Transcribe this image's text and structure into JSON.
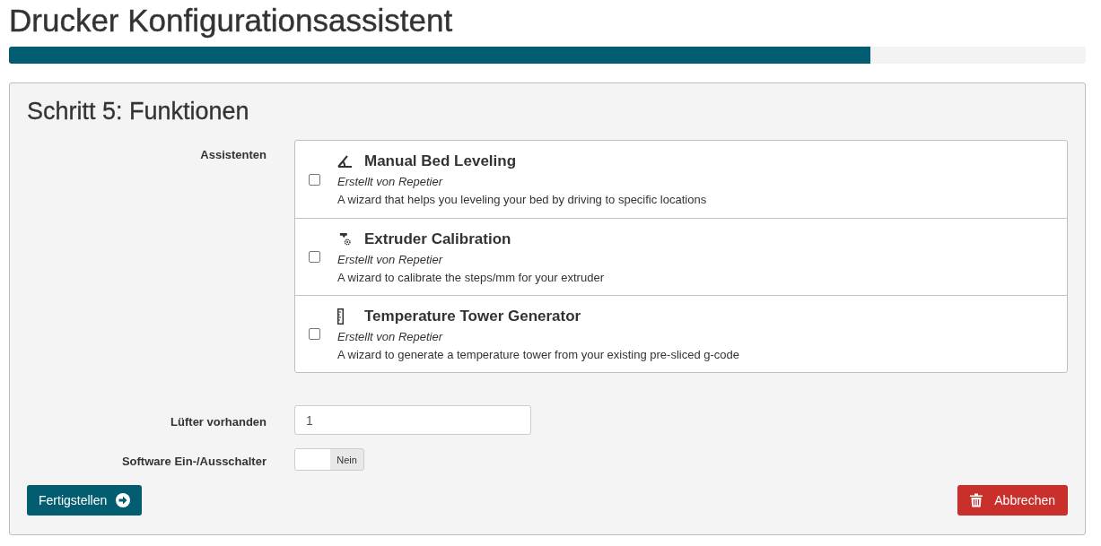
{
  "header": {
    "title": "Drucker Konfigurationsassistent"
  },
  "progress": {
    "level": 0.8
  },
  "step": {
    "title": "Schritt 5: Funktionen",
    "fields": [
      {
        "kind": "wizards",
        "label": "Assistenten",
        "items": [
          {
            "kind": "angle",
            "name": "Manual Bed Leveling",
            "author": "Erstellt von Repetier",
            "description": "A wizard that helps you leveling your bed by driving to specific locations",
            "checked": false
          },
          {
            "kind": "extruder",
            "name": "Extruder Calibration",
            "author": "Erstellt von Repetier",
            "description": "A wizard to calibrate the steps/mm for your extruder",
            "checked": false
          },
          {
            "kind": "ruler",
            "name": "Temperature Tower Generator",
            "author": "Erstellt von Repetier",
            "description": "A wizard to generate a temperature tower from your existing pre-sliced g-code",
            "checked": false
          }
        ]
      },
      {
        "kind": "input",
        "label": "Lüfter vorhanden",
        "value": "1"
      },
      {
        "kind": "toggle",
        "label": "Software Ein-/Ausschalter",
        "on": false,
        "text": "Nein"
      }
    ]
  },
  "buttons": [
    {
      "kind": "primary",
      "label": "Fertigstellen"
    },
    {
      "kind": "danger",
      "label": "Abbrechen"
    }
  ]
}
